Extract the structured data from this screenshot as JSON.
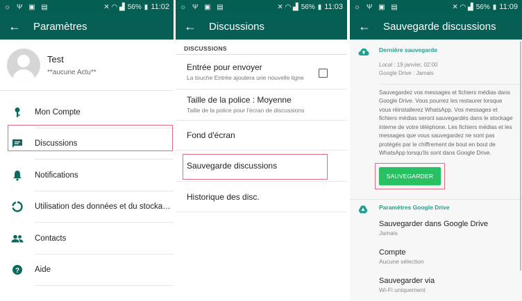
{
  "status": {
    "battery": "56%",
    "times": [
      "11:02",
      "11:03",
      "11:09"
    ]
  },
  "screen1": {
    "title": "Paramètres",
    "profile": {
      "name": "Test",
      "status": "**aucune Actu**"
    },
    "items": [
      {
        "label": "Mon Compte",
        "icon": "key-icon"
      },
      {
        "label": "Discussions",
        "icon": "chat-icon"
      },
      {
        "label": "Notifications",
        "icon": "bell-icon"
      },
      {
        "label": "Utilisation des données et du stocka…",
        "icon": "data-usage-icon"
      },
      {
        "label": "Contacts",
        "icon": "contacts-icon"
      },
      {
        "label": "Aide",
        "icon": "help-icon"
      }
    ]
  },
  "screen2": {
    "title": "Discussions",
    "section": "DISCUSSIONS",
    "enter_send": {
      "title": "Entrée pour envoyer",
      "subtitle": "La touche Entrée ajoutera une nouvelle ligne"
    },
    "font_size": {
      "title": "Taille de la police : Moyenne",
      "subtitle": "Taille de la police pour l'écran de discussions"
    },
    "wallpaper": "Fond d'écran",
    "backup": "Sauvegarde discussions",
    "history": "Historique des disc."
  },
  "screen3": {
    "title": "Sauvegarde discussions",
    "last_backup": {
      "heading": "Dernière sauvegarde",
      "local": "Local : 19 janvier, 02:00",
      "drive": "Google Drive : Jamais",
      "description": "Sauvegardez vos messages et fichiers médias dans Google Drive. Vous pourrez les restaurer lorsque vous réinstallerez WhatsApp. Vos messages et fichiers médias seront sauvegardés dans le stockage interne de votre téléphone. Les fichiers médias et les messages que vous sauvegardez ne sont pas protégés par le chiffrement de bout en bout de WhatsApp lorsqu'ils sont dans Google Drive."
    },
    "save_button": "SAUVEGARDER",
    "drive_settings": {
      "heading": "Paramètres Google Drive",
      "items": [
        {
          "title": "Sauvegarder dans Google Drive",
          "subtitle": "Jamais"
        },
        {
          "title": "Compte",
          "subtitle": "Aucune sélection"
        },
        {
          "title": "Sauvegarder via",
          "subtitle": "Wi-Fi uniquement"
        }
      ]
    }
  },
  "colors": {
    "status_bar": "#055e52",
    "app_bar": "#075e54",
    "accent": "#1fa08f",
    "button": "#29c064",
    "highlight": "#e06a80"
  }
}
